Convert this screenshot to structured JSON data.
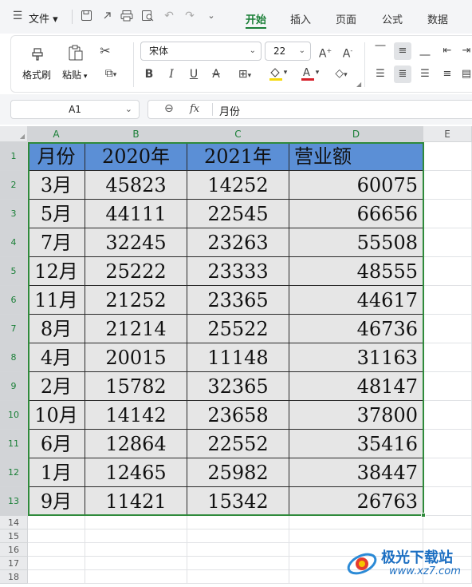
{
  "menubar": {
    "file_label": "文件",
    "tabs": [
      {
        "label": "开始",
        "active": true
      },
      {
        "label": "插入",
        "active": false
      },
      {
        "label": "页面",
        "active": false
      },
      {
        "label": "公式",
        "active": false
      },
      {
        "label": "数据",
        "active": false
      }
    ]
  },
  "ribbon": {
    "format_painter_label": "格式刷",
    "paste_label": "粘贴",
    "font_name": "宋体",
    "font_size": "22"
  },
  "formula_bar": {
    "cell_ref": "A1",
    "fx_label": "fx",
    "content": "月份"
  },
  "grid": {
    "columns": [
      "A",
      "B",
      "C",
      "D",
      "E"
    ],
    "rows": [
      "1",
      "2",
      "3",
      "4",
      "5",
      "6",
      "7",
      "8",
      "9",
      "10",
      "11",
      "12",
      "13",
      "14",
      "15",
      "16",
      "17",
      "18"
    ],
    "header": [
      "月份",
      "2020年",
      "2021年",
      "营业额"
    ],
    "data": [
      [
        "3月",
        "45823",
        "14252",
        "60075"
      ],
      [
        "5月",
        "44111",
        "22545",
        "66656"
      ],
      [
        "7月",
        "32245",
        "23263",
        "55508"
      ],
      [
        "12月",
        "25222",
        "23333",
        "48555"
      ],
      [
        "11月",
        "21252",
        "23365",
        "44617"
      ],
      [
        "8月",
        "21214",
        "25522",
        "46736"
      ],
      [
        "4月",
        "20015",
        "11148",
        "31163"
      ],
      [
        "2月",
        "15782",
        "32365",
        "48147"
      ],
      [
        "10月",
        "14142",
        "23658",
        "37800"
      ],
      [
        "6月",
        "12864",
        "22552",
        "35416"
      ],
      [
        "1月",
        "12465",
        "25982",
        "38447"
      ],
      [
        "9月",
        "11421",
        "15342",
        "26763"
      ]
    ]
  },
  "watermark": {
    "name": "极光下载站",
    "url": "www.xz7.com"
  },
  "colors": {
    "accent": "#1a7f37",
    "header_fill": "#5b8fd6",
    "data_fill": "#e6e6e6",
    "selection": "#2f8a3b"
  }
}
